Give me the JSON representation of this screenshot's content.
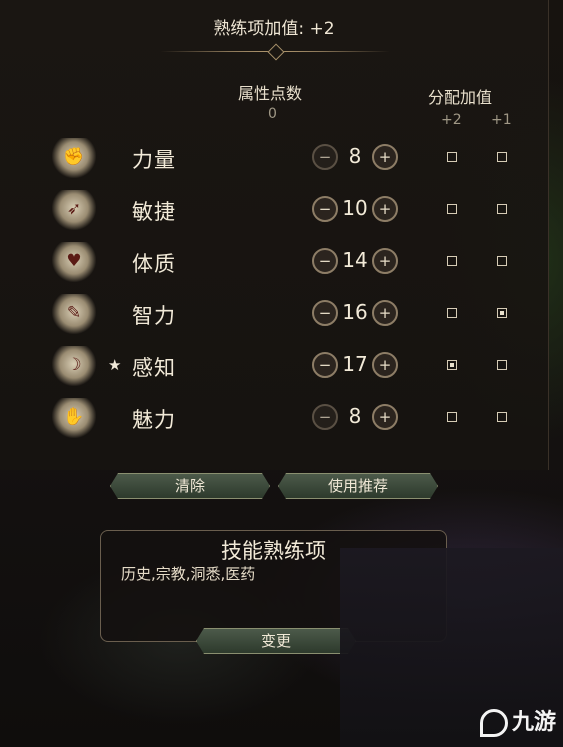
{
  "header": {
    "proficiency_bonus": "熟练项加值: +2"
  },
  "columns": {
    "points_label": "属性点数",
    "points_remaining": "0",
    "bonus_label": "分配加值",
    "bonus_plus2": "+2",
    "bonus_plus1": "+1"
  },
  "abilities": [
    {
      "name": "力量",
      "value": "8",
      "icon": "gauntlet-icon",
      "glyph": "✊",
      "starred": false,
      "plus2": false,
      "plus1": false
    },
    {
      "name": "敏捷",
      "value": "10",
      "icon": "boot-icon",
      "glyph": "➶",
      "starred": false,
      "plus2": false,
      "plus1": false
    },
    {
      "name": "体质",
      "value": "14",
      "icon": "heart-shield-icon",
      "glyph": "♥",
      "starred": false,
      "plus2": false,
      "plus1": false
    },
    {
      "name": "智力",
      "value": "16",
      "icon": "open-book-icon",
      "glyph": "✎",
      "starred": false,
      "plus2": false,
      "plus1": true
    },
    {
      "name": "感知",
      "value": "17",
      "icon": "mask-feather-icon",
      "glyph": "☽",
      "starred": true,
      "star": "★",
      "plus2": true,
      "plus1": false
    },
    {
      "name": "魅力",
      "value": "8",
      "icon": "handshake-icon",
      "glyph": "✋",
      "starred": false,
      "plus2": false,
      "plus1": false
    }
  ],
  "stepper": {
    "minus": "−",
    "plus": "+"
  },
  "actions": {
    "clear": "清除",
    "use_recommended": "使用推荐"
  },
  "skills": {
    "title": "技能熟练项",
    "list": "历史,宗教,洞悉,医药",
    "change": "变更"
  },
  "watermark": {
    "text": "九游"
  },
  "colors": {
    "accent_green": "#4c5a4a",
    "text": "#f2ead8",
    "border": "#8d7d66"
  }
}
